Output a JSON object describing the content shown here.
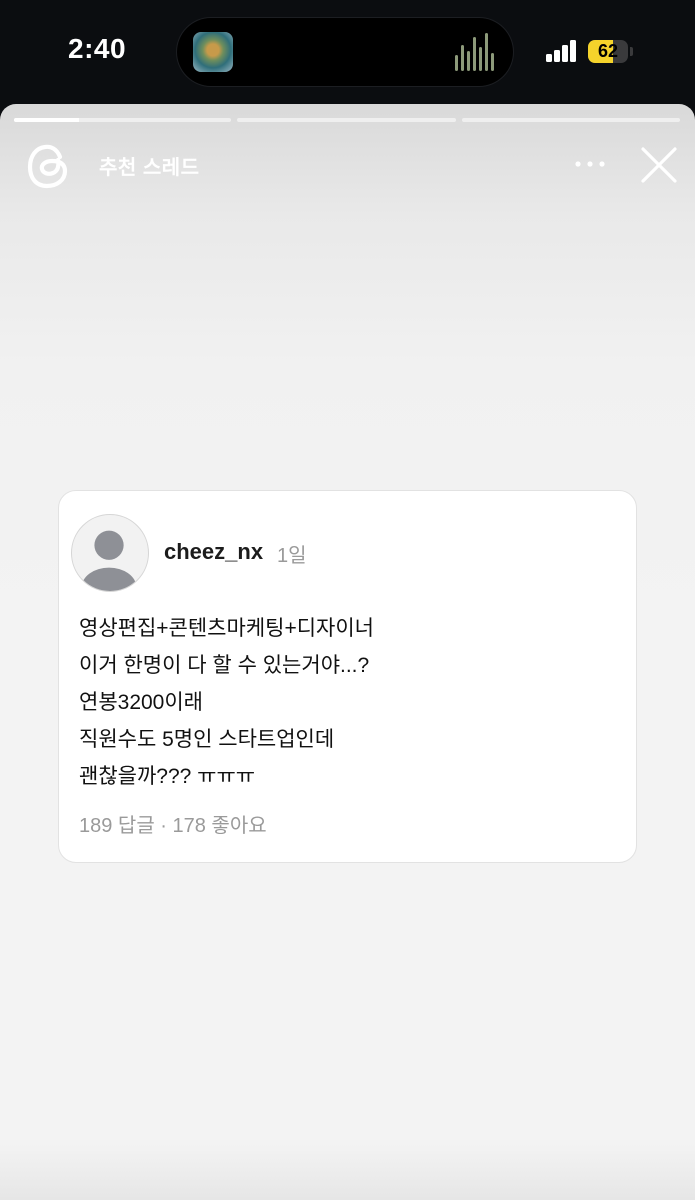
{
  "status_bar": {
    "time": "2:40",
    "battery_level": "62",
    "signal_bars": 4
  },
  "story": {
    "progress_segments": [
      0.3,
      0,
      0,
      0
    ],
    "header": {
      "app_icon": "threads-logo-icon",
      "label": "추천 스레드"
    },
    "actions": {
      "more_icon": "more-icon",
      "close_icon": "close-icon"
    }
  },
  "post": {
    "username": "cheez_nx",
    "time_ago": "1일",
    "lines": [
      "영상편집+콘텐츠마케팅+디자이너",
      "이거 한명이 다 할 수 있는거야...?",
      "연봉3200이래",
      "직원수도 5명인 스타트업인데",
      "괜찮을까??? ㅠㅠㅠ"
    ],
    "stats": "189 답글 · 178 좋아요"
  },
  "colors": {
    "battery": "#f5d32b",
    "status_bg": "#0b0d10",
    "muted_text": "#9a9a9a"
  }
}
